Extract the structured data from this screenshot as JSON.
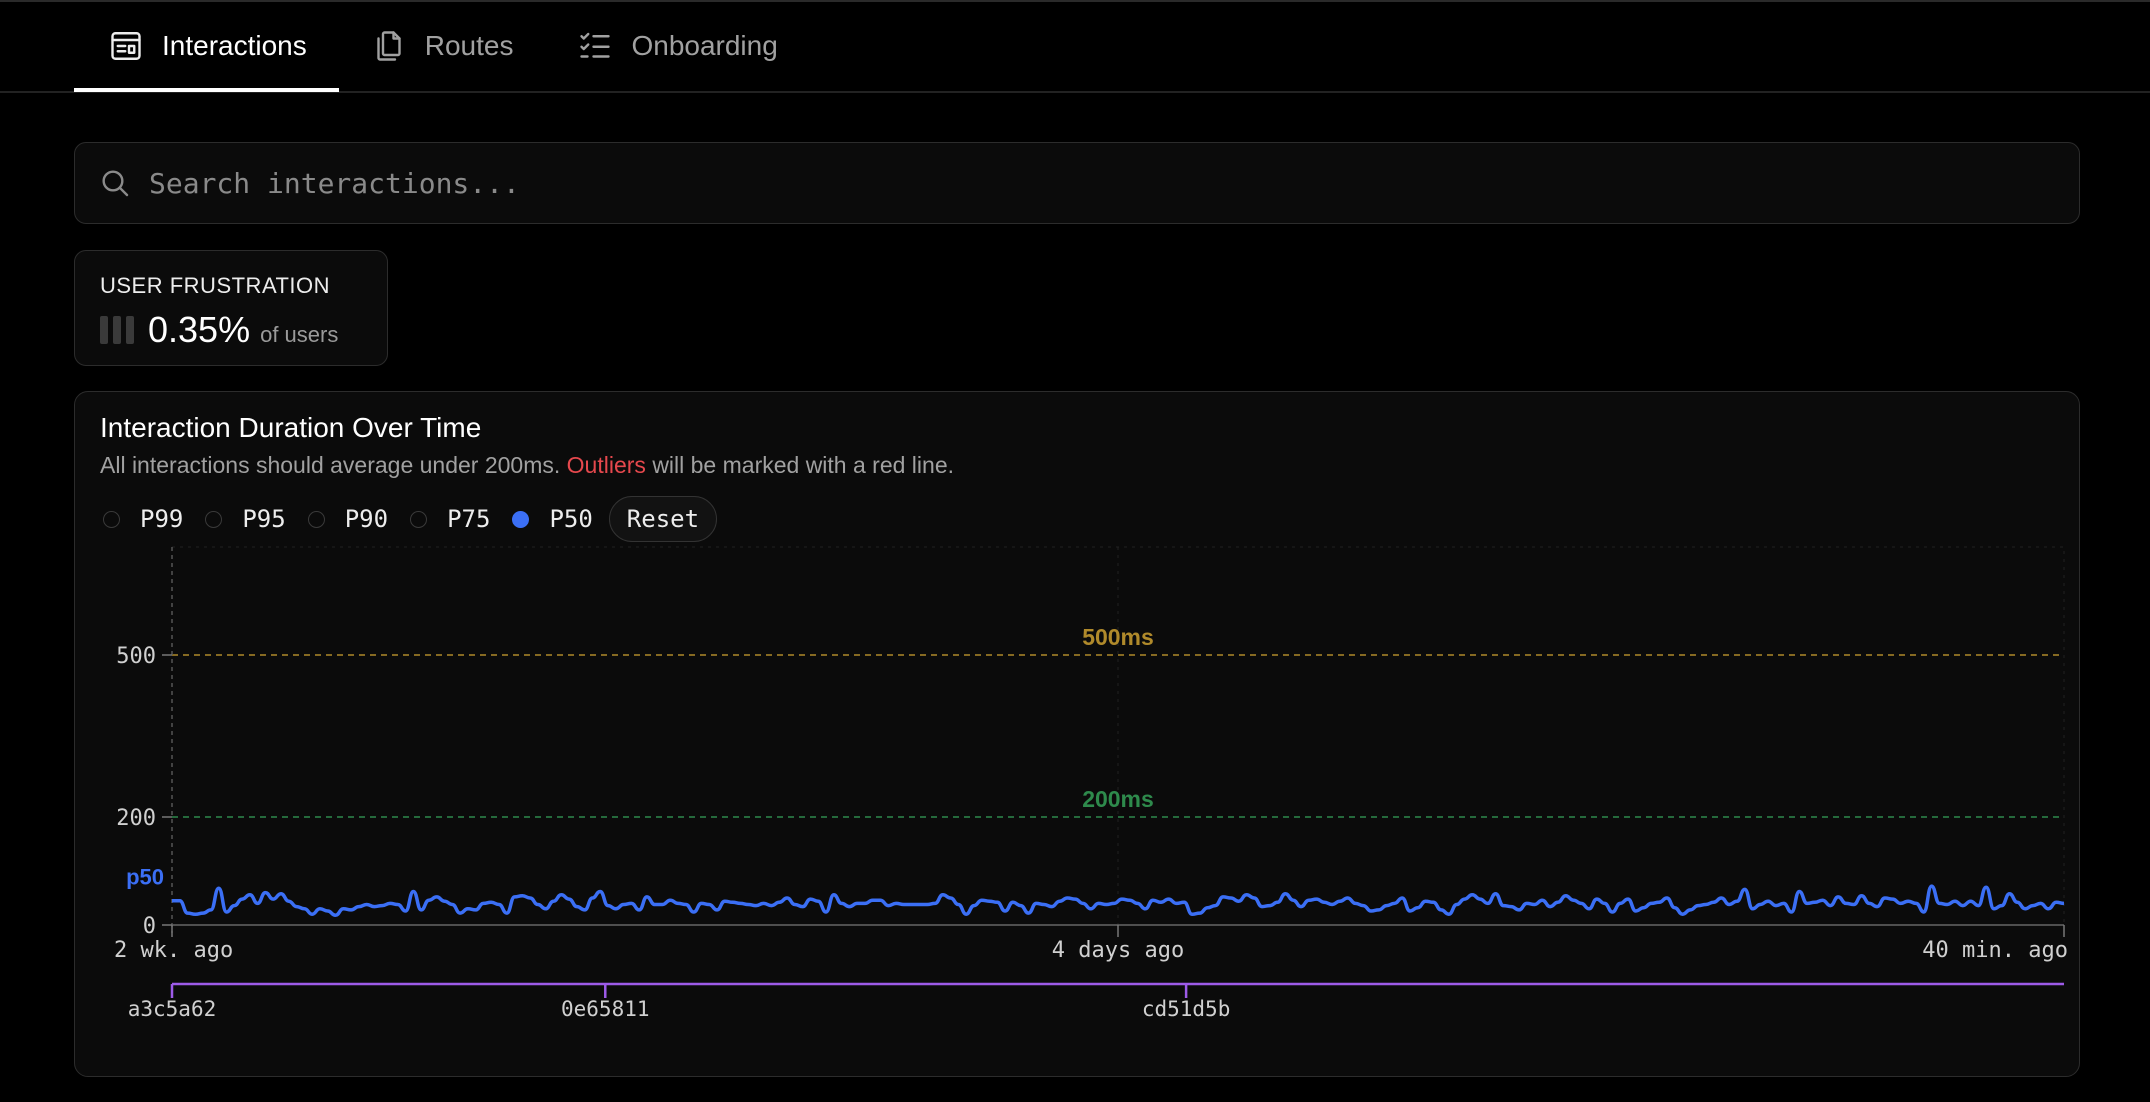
{
  "tabs": [
    {
      "label": "Interactions",
      "icon": "layout-icon",
      "active": true
    },
    {
      "label": "Routes",
      "icon": "copy-icon",
      "active": false
    },
    {
      "label": "Onboarding",
      "icon": "checklist-icon",
      "active": false
    }
  ],
  "search": {
    "placeholder": "Search interactions..."
  },
  "metric": {
    "label": "USER FRUSTRATION",
    "value": "0.35%",
    "unit": "of users"
  },
  "panel": {
    "title": "Interaction Duration Over Time",
    "desc_before": "All interactions should average under 200ms.",
    "desc_highlight": "Outliers",
    "desc_after": "will be marked with a red line.",
    "percentiles": [
      {
        "label": "P99",
        "selected": false
      },
      {
        "label": "P95",
        "selected": false
      },
      {
        "label": "P90",
        "selected": false
      },
      {
        "label": "P75",
        "selected": false
      },
      {
        "label": "P50",
        "selected": true
      }
    ],
    "reset_label": "Reset"
  },
  "colors": {
    "accent": "#3b6ff5",
    "warning": "#b08a2b",
    "ok": "#2e8a4c",
    "commit": "#9d5be8",
    "outlier": "#e5484d"
  },
  "chart_data": {
    "type": "line",
    "series": [
      {
        "name": "p50",
        "values": [
          45,
          45,
          22,
          20,
          22,
          28,
          68,
          24,
          36,
          48,
          56,
          40,
          60,
          48,
          58,
          44,
          34,
          30,
          20,
          30,
          26,
          18,
          30,
          28,
          34,
          38,
          34,
          36,
          40,
          38,
          26,
          62,
          28,
          46,
          52,
          44,
          38,
          22,
          30,
          28,
          40,
          42,
          38,
          22,
          52,
          54,
          50,
          38,
          30,
          44,
          56,
          48,
          34,
          28,
          50,
          62,
          36,
          30,
          38,
          40,
          28,
          52,
          38,
          38,
          46,
          40,
          38,
          24,
          40,
          38,
          28,
          44,
          42,
          40,
          38,
          36,
          40,
          36,
          42,
          50,
          38,
          34,
          48,
          44,
          24,
          56,
          40,
          34,
          40,
          40,
          46,
          46,
          36,
          40,
          38,
          38,
          38,
          38,
          40,
          56,
          50,
          38,
          20,
          36,
          46,
          44,
          42,
          26,
          42,
          36,
          22,
          40,
          38,
          34,
          44,
          50,
          48,
          40,
          30,
          40,
          38,
          40,
          48,
          46,
          40,
          30,
          46,
          42,
          48,
          40,
          42,
          20,
          22,
          32,
          36,
          52,
          50,
          44,
          56,
          50,
          34,
          36,
          42,
          58,
          46,
          34,
          46,
          48,
          42,
          38,
          44,
          50,
          40,
          36,
          26,
          28,
          36,
          40,
          50,
          26,
          32,
          44,
          42,
          28,
          20,
          38,
          48,
          56,
          48,
          40,
          58,
          36,
          34,
          28,
          40,
          38,
          46,
          34,
          42,
          54,
          46,
          40,
          30,
          48,
          40,
          24,
          40,
          48,
          26,
          32,
          40,
          42,
          50,
          32,
          20,
          28,
          36,
          38,
          42,
          50,
          38,
          44,
          66,
          30,
          38,
          44,
          36,
          40,
          24,
          62,
          40,
          42,
          46,
          36,
          52,
          40,
          38,
          54,
          40,
          34,
          50,
          48,
          40,
          44,
          40,
          24,
          72,
          40,
          38,
          44,
          36,
          44,
          36,
          70,
          30,
          36,
          58,
          42,
          30,
          36,
          40,
          30,
          42,
          40
        ]
      }
    ],
    "x_ticks": [
      "2 wk. ago",
      "4 days ago",
      "40 min. ago"
    ],
    "y_ticks": [
      0,
      200,
      500
    ],
    "ylim": [
      0,
      600
    ],
    "thresholds": [
      {
        "value": 500,
        "label": "500ms"
      },
      {
        "value": 200,
        "label": "200ms"
      }
    ],
    "series_label": "p50",
    "commits": [
      "a3c5a62",
      "0e65811",
      "cd51d5b"
    ],
    "commit_positions": [
      0,
      0.229,
      0.536
    ],
    "grid": true
  }
}
